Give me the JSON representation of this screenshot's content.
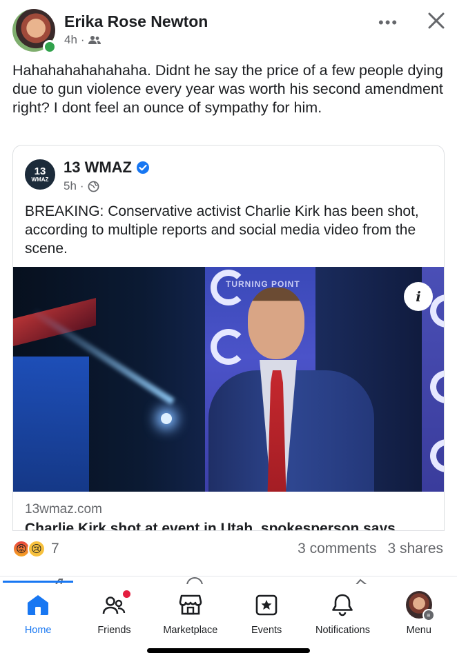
{
  "post": {
    "author": "Erika Rose Newton",
    "time": "4h",
    "text": "Hahahahahahahaha. Didnt he say the price of a few people dying due to gun violence every year was worth his second amendment right? I dont feel an ounce of sympathy for him."
  },
  "shared": {
    "page_name": "13 WMAZ",
    "logo_number": "13",
    "logo_text": "WMAZ",
    "time": "5h",
    "text": "BREAKING: Conservative activist Charlie Kirk has been shot, according to multiple reports and social media video from the scene.",
    "image_banner_text": "TURNING POINT",
    "info_label": "i",
    "domain": "13wmaz.com",
    "title": "Charlie Kirk shot at event in Utah, spokesperson says"
  },
  "engagement": {
    "reaction_count": "7",
    "comments": "3 comments",
    "shares": "3 shares"
  },
  "tabs": [
    {
      "label": "Home",
      "icon": "home-icon"
    },
    {
      "label": "Friends",
      "icon": "friends-icon"
    },
    {
      "label": "Marketplace",
      "icon": "marketplace-icon"
    },
    {
      "label": "Events",
      "icon": "events-icon"
    },
    {
      "label": "Notifications",
      "icon": "bell-icon"
    },
    {
      "label": "Menu",
      "icon": "avatar"
    }
  ],
  "colors": {
    "accent": "#1877f2",
    "secondary_text": "#65676b",
    "online": "#31a24c",
    "badge": "#e41e3f"
  }
}
